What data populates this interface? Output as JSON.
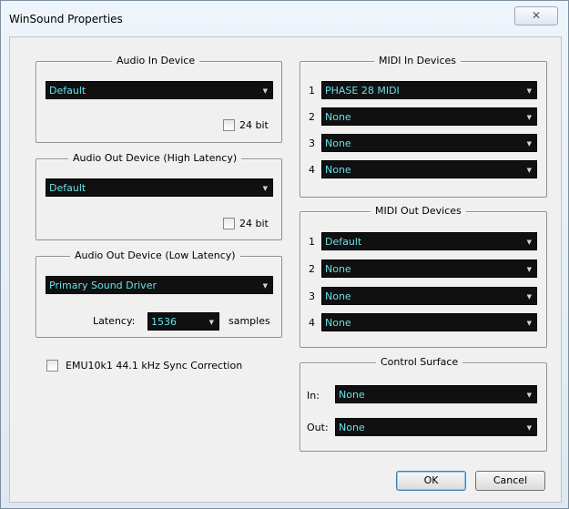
{
  "window": {
    "title": "WinSound Properties",
    "close_glyph": "✕"
  },
  "audio_in": {
    "legend": "Audio In Device",
    "device": "Default",
    "bit24_label": "24 bit",
    "bit24_checked": false
  },
  "audio_out_high": {
    "legend": "Audio Out Device (High Latency)",
    "device": "Default",
    "bit24_label": "24 bit",
    "bit24_checked": false
  },
  "audio_out_low": {
    "legend": "Audio Out Device (Low Latency)",
    "device": "Primary Sound Driver",
    "latency_label": "Latency:",
    "latency_value": "1536",
    "samples_label": "samples"
  },
  "sync_correction": {
    "label": "EMU10k1 44.1 kHz Sync Correction",
    "checked": false
  },
  "midi_in": {
    "legend": "MIDI In Devices",
    "rows": [
      {
        "num": "1",
        "value": "PHASE 28 MIDI"
      },
      {
        "num": "2",
        "value": "None"
      },
      {
        "num": "3",
        "value": "None"
      },
      {
        "num": "4",
        "value": "None"
      }
    ]
  },
  "midi_out": {
    "legend": "MIDI Out Devices",
    "rows": [
      {
        "num": "1",
        "value": "Default"
      },
      {
        "num": "2",
        "value": "None"
      },
      {
        "num": "3",
        "value": "None"
      },
      {
        "num": "4",
        "value": "None"
      }
    ]
  },
  "control_surface": {
    "legend": "Control Surface",
    "in_label": "In:",
    "in_value": "None",
    "out_label": "Out:",
    "out_value": "None"
  },
  "buttons": {
    "ok": "OK",
    "cancel": "Cancel"
  },
  "icons": {
    "dropdown": "chevron-down-icon"
  },
  "colors": {
    "combo_bg": "#101010",
    "combo_text": "#66e0e8"
  }
}
